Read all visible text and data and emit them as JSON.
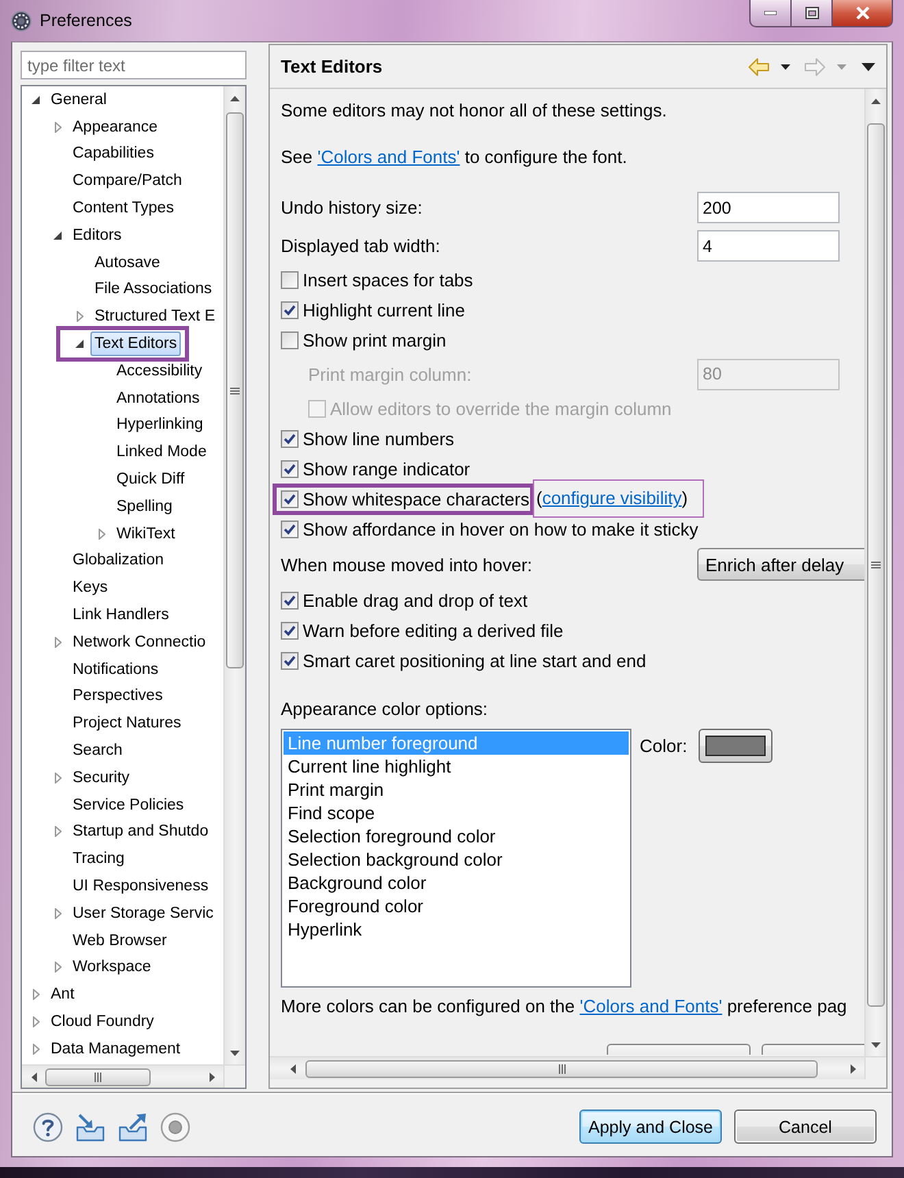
{
  "window": {
    "title": "Preferences"
  },
  "filter": {
    "placeholder": "type filter text"
  },
  "tree": [
    {
      "label": "General",
      "expanded": true,
      "selected": false,
      "framed": false,
      "children": [
        {
          "label": "Appearance",
          "expanded": false,
          "selected": false,
          "framed": false
        },
        {
          "label": "Capabilities",
          "selected": false,
          "framed": false
        },
        {
          "label": "Compare/Patch",
          "selected": false,
          "framed": false
        },
        {
          "label": "Content Types",
          "selected": false,
          "framed": false
        },
        {
          "label": "Editors",
          "expanded": true,
          "selected": false,
          "framed": false,
          "children": [
            {
              "label": "Autosave",
              "selected": false,
              "framed": false
            },
            {
              "label": "File Associations",
              "selected": false,
              "framed": false
            },
            {
              "label": "Structured Text E",
              "expanded": false,
              "selected": false,
              "framed": false
            },
            {
              "label": "Text Editors",
              "expanded": true,
              "selected": true,
              "framed": true,
              "children": [
                {
                  "label": "Accessibility",
                  "selected": false,
                  "framed": false
                },
                {
                  "label": "Annotations",
                  "selected": false,
                  "framed": false
                },
                {
                  "label": "Hyperlinking",
                  "selected": false,
                  "framed": false
                },
                {
                  "label": "Linked Mode",
                  "selected": false,
                  "framed": false
                },
                {
                  "label": "Quick Diff",
                  "selected": false,
                  "framed": false
                },
                {
                  "label": "Spelling",
                  "selected": false,
                  "framed": false
                },
                {
                  "label": "WikiText",
                  "expanded": false,
                  "selected": false,
                  "framed": false
                }
              ]
            }
          ]
        },
        {
          "label": "Globalization",
          "selected": false,
          "framed": false
        },
        {
          "label": "Keys",
          "selected": false,
          "framed": false
        },
        {
          "label": "Link Handlers",
          "selected": false,
          "framed": false
        },
        {
          "label": "Network Connectio",
          "expanded": false,
          "selected": false,
          "framed": false
        },
        {
          "label": "Notifications",
          "selected": false,
          "framed": false
        },
        {
          "label": "Perspectives",
          "selected": false,
          "framed": false
        },
        {
          "label": "Project Natures",
          "selected": false,
          "framed": false
        },
        {
          "label": "Search",
          "selected": false,
          "framed": false
        },
        {
          "label": "Security",
          "expanded": false,
          "selected": false,
          "framed": false
        },
        {
          "label": "Service Policies",
          "selected": false,
          "framed": false
        },
        {
          "label": "Startup and Shutdo",
          "expanded": false,
          "selected": false,
          "framed": false
        },
        {
          "label": "Tracing",
          "selected": false,
          "framed": false
        },
        {
          "label": "UI Responsiveness",
          "selected": false,
          "framed": false
        },
        {
          "label": "User Storage Servic",
          "expanded": false,
          "selected": false,
          "framed": false
        },
        {
          "label": "Web Browser",
          "selected": false,
          "framed": false
        },
        {
          "label": "Workspace",
          "expanded": false,
          "selected": false,
          "framed": false
        }
      ]
    },
    {
      "label": "Ant",
      "expanded": false,
      "selected": false,
      "framed": false
    },
    {
      "label": "Cloud Foundry",
      "expanded": false,
      "selected": false,
      "framed": false
    },
    {
      "label": "Data Management",
      "expanded": false,
      "selected": false,
      "framed": false
    }
  ],
  "page": {
    "title": "Text Editors",
    "settings": [
      {
        "kind": "note",
        "text": "Some editors may not honor all of these settings."
      },
      {
        "kind": "note",
        "text": "See ",
        "link": "'Colors and Fonts'",
        "after": " to configure the font."
      },
      {
        "kind": "field",
        "label": "Undo history size:",
        "value": "200",
        "disabled": false
      },
      {
        "kind": "field",
        "label": "Displayed tab width:",
        "value": "4",
        "disabled": false
      },
      {
        "kind": "checkbox",
        "label": "Insert spaces for tabs",
        "checked": false,
        "disabled": false,
        "framed": false
      },
      {
        "kind": "checkbox",
        "label": "Highlight current line",
        "checked": true,
        "disabled": false,
        "framed": false
      },
      {
        "kind": "checkbox",
        "label": "Show print margin",
        "checked": false,
        "disabled": false,
        "framed": false,
        "children": [
          {
            "kind": "field",
            "label": "Print margin column:",
            "value": "80",
            "disabled": true
          },
          {
            "kind": "checkbox",
            "label": "Allow editors to override the margin column",
            "checked": false,
            "disabled": true,
            "framed": false
          }
        ]
      },
      {
        "kind": "checkbox",
        "label": "Show line numbers",
        "checked": true,
        "disabled": false,
        "framed": false
      },
      {
        "kind": "checkbox",
        "label": "Show range indicator",
        "checked": true,
        "disabled": false,
        "framed": false
      },
      {
        "kind": "checkbox",
        "label": "Show whitespace characters",
        "checked": true,
        "disabled": false,
        "framed": true,
        "note": {
          "text": "(",
          "link": "configure visibility",
          "after": ")",
          "framed": true
        }
      },
      {
        "kind": "checkbox",
        "label": "Show affordance in hover on how to make it sticky",
        "checked": true,
        "disabled": false,
        "framed": false
      },
      {
        "kind": "combo",
        "label": "When mouse moved into hover:",
        "value": "Enrich after delay"
      },
      {
        "kind": "checkbox",
        "label": "Enable drag and drop of text",
        "checked": true,
        "disabled": false,
        "framed": false
      },
      {
        "kind": "checkbox",
        "label": "Warn before editing a derived file",
        "checked": true,
        "disabled": false,
        "framed": false
      },
      {
        "kind": "checkbox",
        "label": "Smart caret positioning at line start and end",
        "checked": true,
        "disabled": false,
        "framed": false
      },
      {
        "kind": "color_list",
        "label": "Appearance color options:",
        "items": [
          {
            "label": "Line number foreground",
            "selected": true
          },
          {
            "label": "Current line highlight",
            "selected": false
          },
          {
            "label": "Print margin",
            "selected": false
          },
          {
            "label": "Find scope",
            "selected": false
          },
          {
            "label": "Selection foreground color",
            "selected": false
          },
          {
            "label": "Selection background color",
            "selected": false
          },
          {
            "label": "Background color",
            "selected": false
          },
          {
            "label": "Foreground color",
            "selected": false
          },
          {
            "label": "Hyperlink",
            "selected": false
          }
        ],
        "color_label": "Color:",
        "color": "#787878"
      },
      {
        "kind": "note",
        "text": "More colors can be configured on the ",
        "link": "'Colors and Fonts'",
        "after": " preference pag"
      }
    ]
  },
  "buttons": [
    {
      "label": "Apply and Close",
      "default": true
    },
    {
      "label": "Cancel",
      "default": false
    }
  ]
}
